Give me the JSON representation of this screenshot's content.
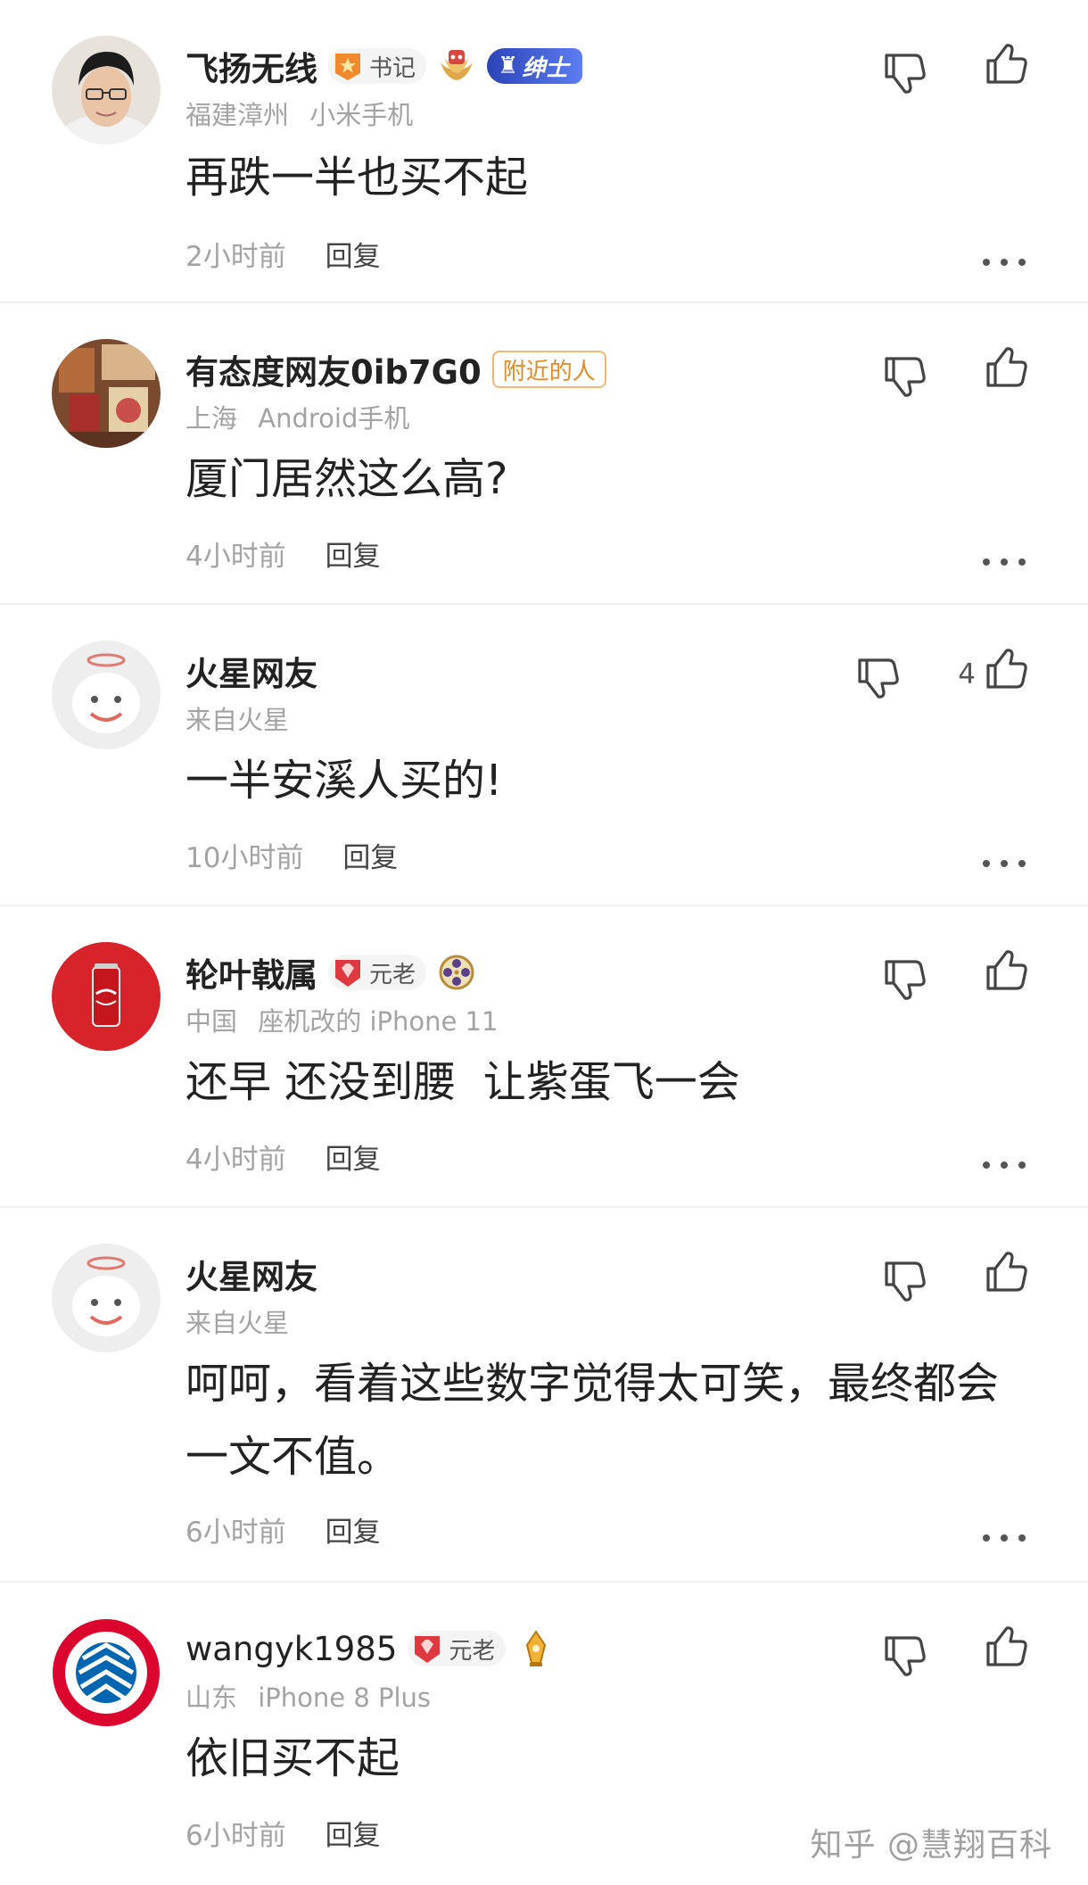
{
  "comments": [
    {
      "username": "飞扬无线",
      "badge_label": "书记",
      "medal": "wings-medal",
      "extra_badge": "绅士",
      "location": "福建漳州",
      "device": "小米手机",
      "text": "再跌一半也买不起",
      "time": "2小时前",
      "reply": "回复"
    },
    {
      "username": "有态度网友0ib7G0",
      "tag": "附近的人",
      "location": "上海",
      "device": "Android手机",
      "text": "厦门居然这么高?",
      "time": "4小时前",
      "reply": "回复"
    },
    {
      "username": "火星网友",
      "location": "来自火星",
      "text": "一半安溪人买的!",
      "time": "10小时前",
      "reply": "回复",
      "like_count": "4"
    },
    {
      "username": "轮叶戟属",
      "badge_label": "元老",
      "medal": "film-reel-medal",
      "location": "中国",
      "device": "座机改的 iPhone 11",
      "text": "还早 还没到腰  让紫蛋飞一会",
      "time": "4小时前",
      "reply": "回复"
    },
    {
      "username": "火星网友",
      "location": "来自火星",
      "text": "呵呵，看着这些数字觉得太可笑，最终都会一文不值。",
      "time": "6小时前",
      "reply": "回复"
    },
    {
      "username": "wangyk1985",
      "badge_label": "元老",
      "medal": "pen-medal",
      "location": "山东",
      "device": "iPhone 8 Plus",
      "text": "依旧买不起",
      "time": "6小时前",
      "reply": "回复"
    }
  ],
  "watermark": "知乎 @慧翔百科",
  "icons": {
    "like": "thumbs-up-icon",
    "dislike": "thumbs-down-icon",
    "more": "more-dots-icon"
  },
  "colors": {
    "name": "#222222",
    "meta": "#a3a3a3",
    "nearby_tag": "#e58a25",
    "gentleman_badge": "#3553d0"
  }
}
